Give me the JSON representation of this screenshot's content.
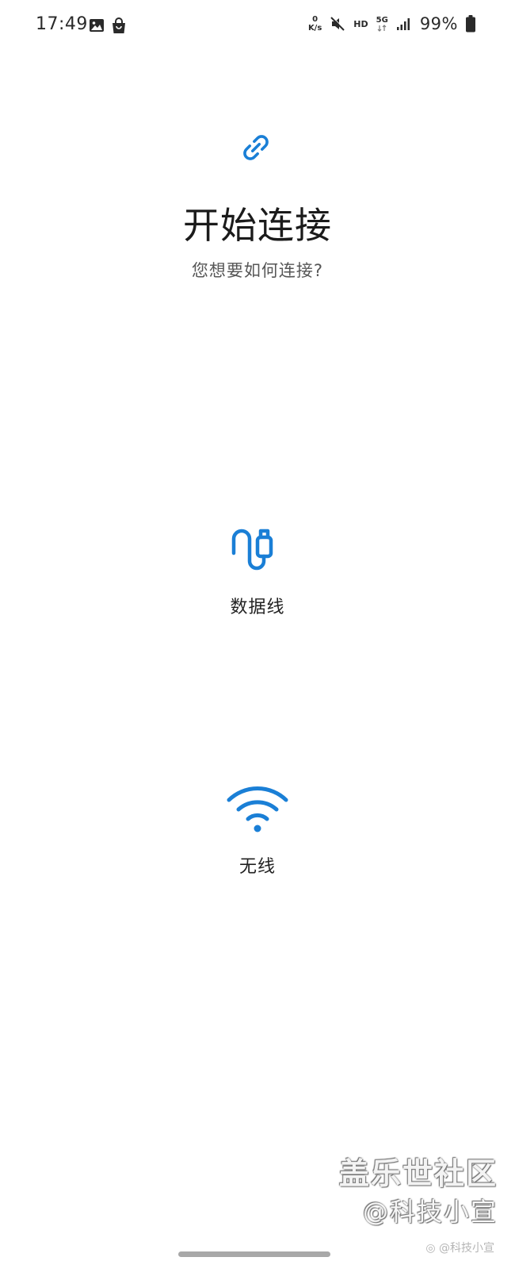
{
  "status_bar": {
    "time": "17:49",
    "left_icons": [
      "image-icon",
      "shopping-bag-icon"
    ],
    "net_speed_value": "0",
    "net_speed_unit": "K/s",
    "hd": "HD",
    "network": "5G",
    "battery": "99%"
  },
  "header": {
    "icon": "link-icon",
    "title": "开始连接",
    "subtitle": "您想要如何连接?"
  },
  "options": [
    {
      "icon": "usb-cable-icon",
      "label": "数据线"
    },
    {
      "icon": "wifi-icon",
      "label": "无线"
    }
  ],
  "watermark": {
    "site": "盖乐世社区",
    "handle": "@科技小宣",
    "weibo": "@科技小宣"
  },
  "colors": {
    "accent": "#1a7fd6",
    "text_primary": "#1b1b1b",
    "text_secondary": "#565656",
    "background": "#ffffff"
  }
}
